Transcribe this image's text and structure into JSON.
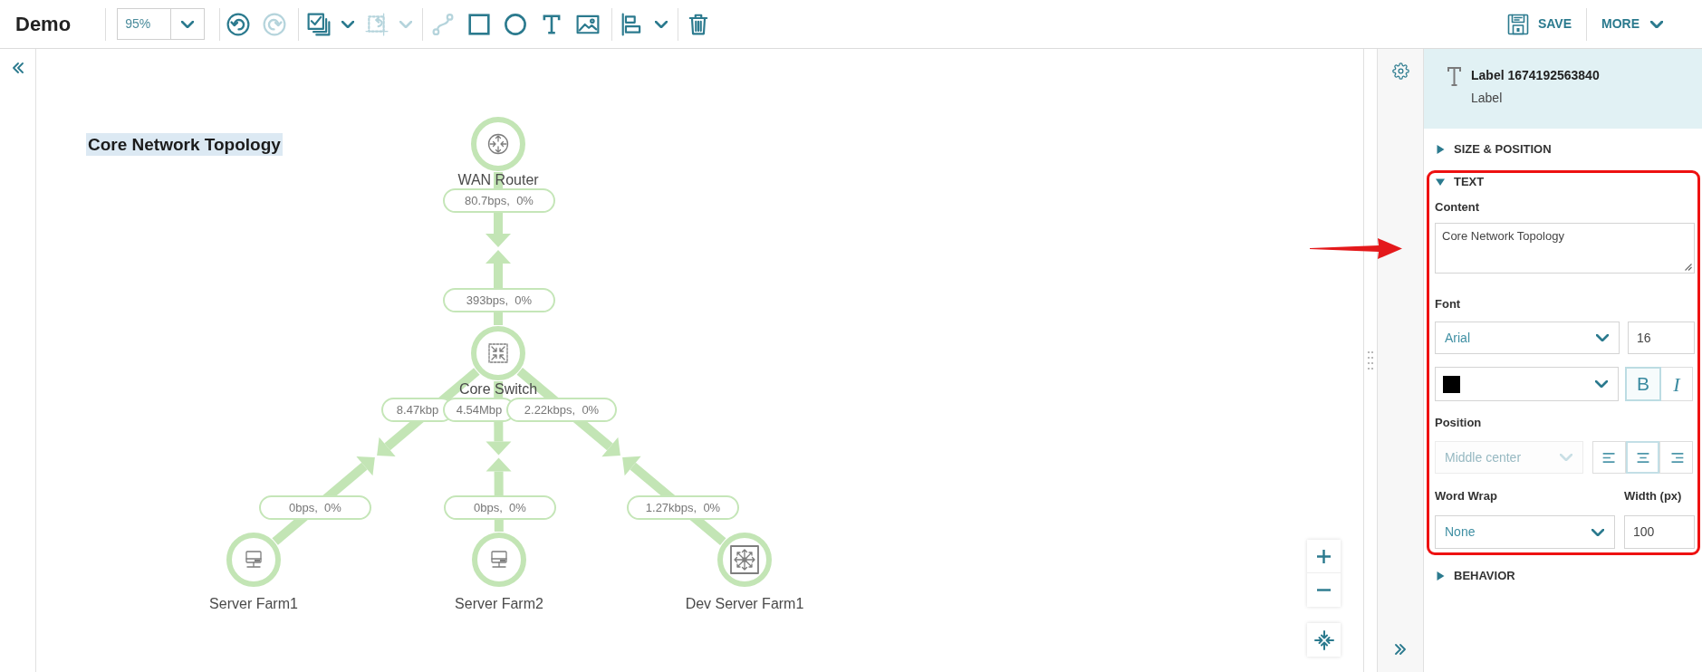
{
  "toolbar": {
    "title": "Demo",
    "zoom": "95%",
    "tool_groups": [
      {
        "tools": [
          {
            "kind": "undo",
            "disabled": false,
            "dropdown": false
          },
          {
            "kind": "redo",
            "disabled": true,
            "dropdown": false
          }
        ]
      },
      {
        "tools": [
          {
            "kind": "layers",
            "disabled": false,
            "dropdown": true
          },
          {
            "kind": "arrange",
            "disabled": true,
            "dropdown": true
          }
        ]
      },
      {
        "tools": [
          {
            "kind": "connector",
            "disabled": true,
            "dropdown": false
          },
          {
            "kind": "rectangle",
            "disabled": false,
            "dropdown": false
          },
          {
            "kind": "ellipse",
            "disabled": false,
            "dropdown": false
          },
          {
            "kind": "text",
            "disabled": false,
            "dropdown": false
          },
          {
            "kind": "image",
            "disabled": false,
            "dropdown": false
          }
        ]
      },
      {
        "tools": [
          {
            "kind": "align",
            "disabled": false,
            "dropdown": true
          }
        ]
      },
      {
        "tools": [
          {
            "kind": "delete",
            "disabled": false,
            "dropdown": false
          }
        ]
      }
    ],
    "actions": [
      {
        "kind": "save",
        "label": "SAVE"
      },
      {
        "kind": "more",
        "label": "MORE"
      }
    ]
  },
  "canvas": {
    "label": {
      "text": "Core Network Topology",
      "selected": true
    },
    "nodes": [
      {
        "name": "WAN Router",
        "kind": "router"
      },
      {
        "name": "Core Switch",
        "kind": "switch"
      },
      {
        "name": "Server Farm1",
        "kind": "server"
      },
      {
        "name": "Server Farm2",
        "kind": "server"
      },
      {
        "name": "Dev Server Farm1",
        "kind": "multilayer_switch"
      }
    ],
    "links": [
      {
        "labels": [
          "80.7bps,  0%",
          "393bps,  0%"
        ]
      },
      {
        "labels": [
          "8.47kbp",
          "0bps,  0%"
        ]
      },
      {
        "labels": [
          "4.54Mbp",
          "0bps,  0%"
        ]
      },
      {
        "labels": [
          "2.22kbps,  0%",
          "1.27kbps,  0%"
        ]
      }
    ]
  },
  "annotations": [
    {
      "kind": "arrow"
    }
  ],
  "properties": {
    "title": "Label 1674192563840",
    "type": "Label",
    "sections": [
      {
        "title": "SIZE & POSITION",
        "expanded": false,
        "highlighted": false
      },
      {
        "title": "TEXT",
        "expanded": true,
        "highlighted": true,
        "content": {
          "label": "Content",
          "value": "Core Network Topology"
        },
        "font": {
          "label": "Font",
          "family": "Arial",
          "size": "16",
          "color": "#000000",
          "bold": {
            "label": "B",
            "selected": true
          },
          "italic": {
            "label": "I",
            "selected": false
          }
        },
        "position": {
          "label": "Position",
          "value": "Middle center",
          "disabled": true,
          "alignments": [
            {
              "kind": "left",
              "selected": false
            },
            {
              "kind": "center",
              "selected": true
            },
            {
              "kind": "right",
              "selected": false
            }
          ]
        },
        "word_wrap": {
          "label": "Word Wrap",
          "value": "None"
        },
        "width": {
          "label": "Width (px)",
          "value": "100"
        }
      },
      {
        "title": "BEHAVIOR",
        "expanded": false,
        "highlighted": false
      }
    ]
  }
}
